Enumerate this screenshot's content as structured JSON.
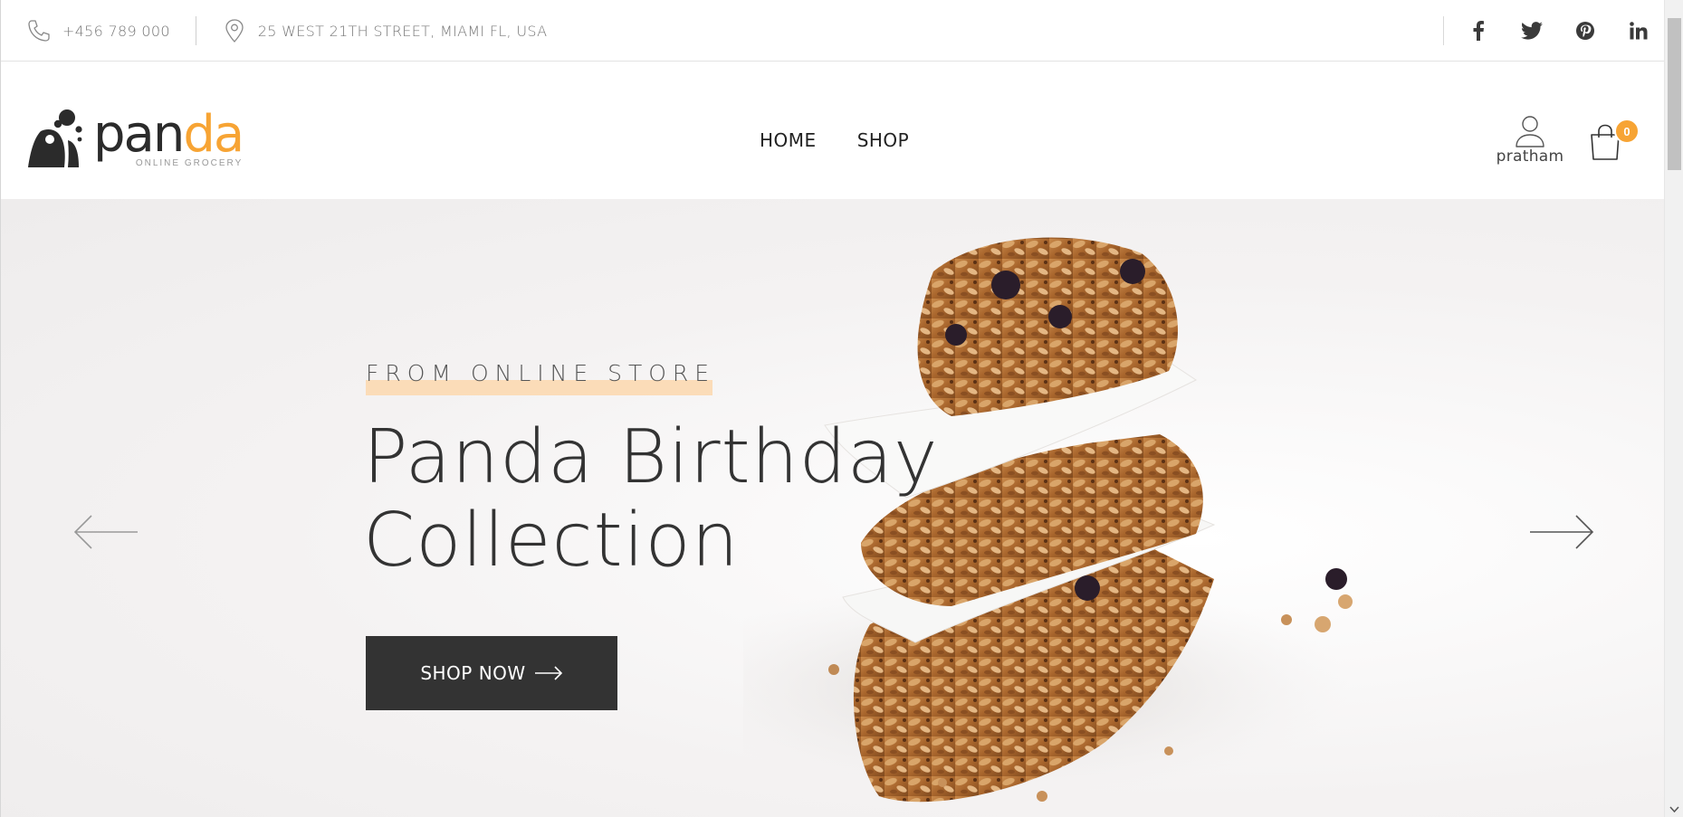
{
  "topbar": {
    "phone": "+456 789 000",
    "address": "25 WEST 21TH STREET, MIAMI FL, USA",
    "social": [
      "facebook-icon",
      "twitter-icon",
      "pinterest-icon",
      "linkedin-icon"
    ]
  },
  "header": {
    "logo_name_part1": "pan",
    "logo_name_part2": "da",
    "logo_tagline": "ONLINE GROCERY",
    "nav": [
      {
        "label": "HOME",
        "active": true
      },
      {
        "label": "SHOP",
        "active": false
      }
    ],
    "account_name": "pratham",
    "cart_count": "0"
  },
  "hero": {
    "eyebrow": "FROM ONLINE STORE",
    "title_line1": "Panda Birthday",
    "title_line2": "Collection",
    "cta_label": "SHOP NOW"
  },
  "colors": {
    "accent": "#f7a434",
    "highlight": "#fbdcb8",
    "button": "#333333",
    "text": "#333333"
  }
}
